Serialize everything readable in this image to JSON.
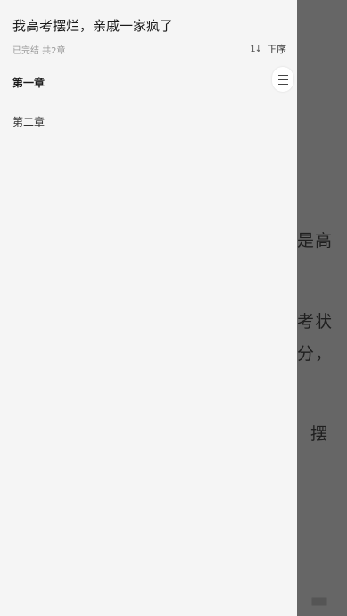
{
  "reader_background": {
    "lines": [
      "是高",
      "考状",
      "分，",
      "摆"
    ]
  },
  "drawer": {
    "book_title": "我高考摆烂，亲戚一家疯了",
    "book_meta": "已完结 共2章",
    "sort": {
      "icon": "sort-arrows-icon",
      "icon_glyph": "1↓",
      "label": "正序"
    },
    "chapters": [
      {
        "label": "第一章",
        "current": true
      },
      {
        "label": "第二章",
        "current": false
      }
    ],
    "scroll_handle_icon": "menu-lines-icon"
  },
  "colors": {
    "drawer_bg": "#f5f5f5",
    "overlay_bg": "#666666",
    "text_primary": "#1a1a1a",
    "text_secondary": "#9a9a9a"
  }
}
